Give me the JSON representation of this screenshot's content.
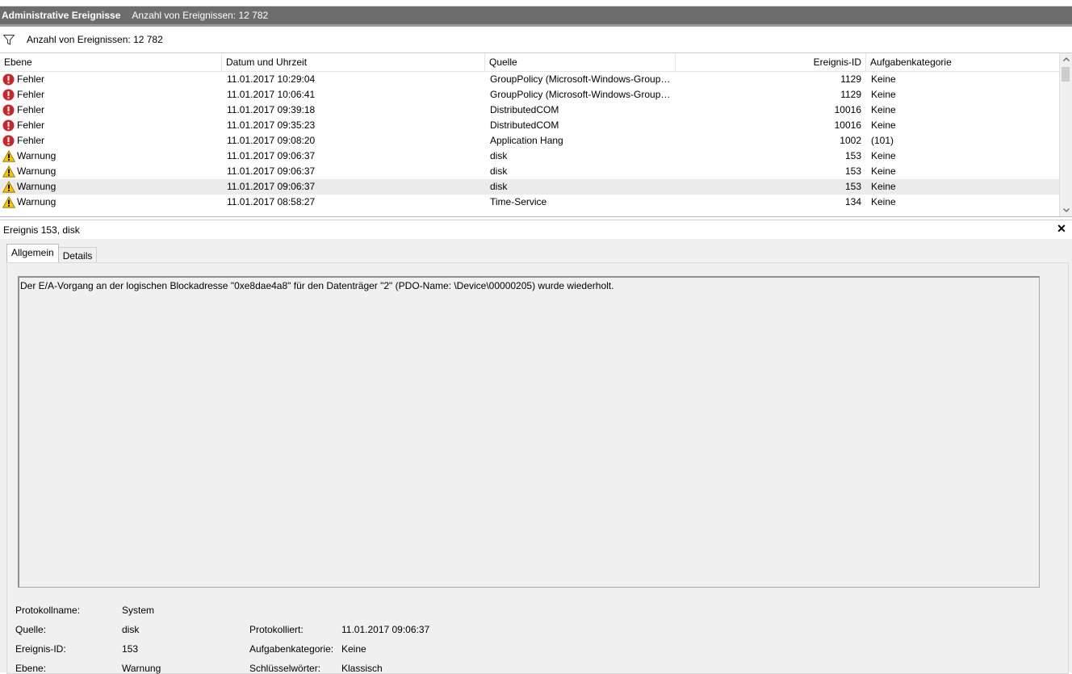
{
  "title_bar": {
    "title": "Administrative Ereignisse",
    "count": "Anzahl von Ereignissen: 12 782"
  },
  "filter_bar": {
    "icon": "filter-icon",
    "text": "Anzahl von Ereignissen: 12 782"
  },
  "columns": [
    "Ebene",
    "Datum und Uhrzeit",
    "Quelle",
    "Ereignis-ID",
    "Aufgabenkategorie"
  ],
  "events": [
    {
      "level": "Fehler",
      "icon": "error-icon",
      "date": "11.01.2017 10:29:04",
      "source": "GroupPolicy (Microsoft-Windows-Group…",
      "id": "1129",
      "category": "Keine"
    },
    {
      "level": "Fehler",
      "icon": "error-icon",
      "date": "11.01.2017 10:06:41",
      "source": "GroupPolicy (Microsoft-Windows-Group…",
      "id": "1129",
      "category": "Keine"
    },
    {
      "level": "Fehler",
      "icon": "error-icon",
      "date": "11.01.2017 09:39:18",
      "source": "DistributedCOM",
      "id": "10016",
      "category": "Keine"
    },
    {
      "level": "Fehler",
      "icon": "error-icon",
      "date": "11.01.2017 09:35:23",
      "source": "DistributedCOM",
      "id": "10016",
      "category": "Keine"
    },
    {
      "level": "Fehler",
      "icon": "error-icon",
      "date": "11.01.2017 09:08:20",
      "source": "Application Hang",
      "id": "1002",
      "category": "(101)"
    },
    {
      "level": "Warnung",
      "icon": "warning-icon",
      "date": "11.01.2017 09:06:37",
      "source": "disk",
      "id": "153",
      "category": "Keine"
    },
    {
      "level": "Warnung",
      "icon": "warning-icon",
      "date": "11.01.2017 09:06:37",
      "source": "disk",
      "id": "153",
      "category": "Keine"
    },
    {
      "level": "Warnung",
      "icon": "warning-icon",
      "date": "11.01.2017 09:06:37",
      "source": "disk",
      "id": "153",
      "category": "Keine",
      "selected": true
    },
    {
      "level": "Warnung",
      "icon": "warning-icon",
      "date": "11.01.2017 08:58:27",
      "source": "Time-Service",
      "id": "134",
      "category": "Keine"
    }
  ],
  "detail": {
    "title": "Ereignis 153, disk",
    "tabs": [
      "Allgemein",
      "Details"
    ],
    "description": "Der E/A-Vorgang an der logischen Blockadresse \"0xe8dae4a8\" für den Datenträger \"2\" (PDO-Name: \\Device\\00000205) wurde wiederholt.",
    "properties": {
      "log_name_label": "Protokollname:",
      "log_name": "System",
      "source_label": "Quelle:",
      "source": "disk",
      "logged_label": "Protokolliert:",
      "logged": "11.01.2017 09:06:37",
      "event_id_label": "Ereignis-ID:",
      "event_id": "153",
      "task_category_label": "Aufgabenkategorie:",
      "task_category": "Keine",
      "level_label": "Ebene:",
      "level": "Warnung",
      "keywords_label": "Schlüsselwörter:",
      "keywords": "Klassisch"
    }
  },
  "colors": {
    "title_bar": "#6d6d6d",
    "selected_row": "#ebebeb",
    "error": "#c8262b",
    "warning": "#f5c500"
  }
}
